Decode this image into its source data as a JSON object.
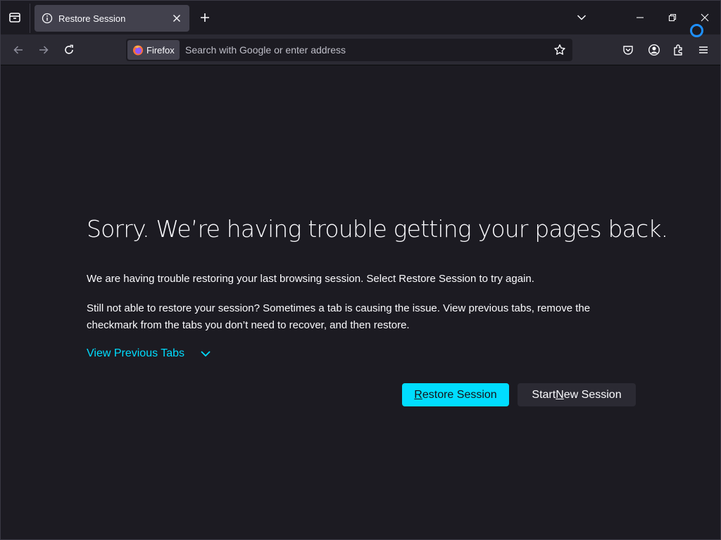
{
  "tab": {
    "title": "Restore Session"
  },
  "urlbar": {
    "identity_label": "Firefox",
    "placeholder": "Search with Google or enter address",
    "value": ""
  },
  "page": {
    "heading": "Sorry. We’re having trouble getting your pages back.",
    "para1": "We are having trouble restoring your last browsing session. Select Restore Session to try again.",
    "para2": "Still not able to restore your session? Sometimes a tab is causing the issue. View previous tabs, remove the checkmark from the tabs you don’t need to recover, and then restore.",
    "view_previous_tabs": "View Previous Tabs",
    "restore_button": {
      "before": "",
      "accel": "R",
      "after": "estore Session"
    },
    "new_session_button": {
      "before": "Start ",
      "accel": "N",
      "after": "ew Session"
    }
  },
  "colors": {
    "accent": "#00ddff",
    "background": "#1c1b22",
    "toolbar": "#2b2a33",
    "tab_selected": "#42414d"
  },
  "icons": [
    "tab-list-icon",
    "info-icon",
    "close-icon",
    "plus-icon",
    "chevron-down-icon",
    "minimize-icon",
    "restore-icon",
    "back-icon",
    "forward-icon",
    "reload-icon",
    "firefox-logo",
    "star-icon",
    "pocket-icon",
    "account-icon",
    "extensions-icon",
    "menu-icon"
  ]
}
